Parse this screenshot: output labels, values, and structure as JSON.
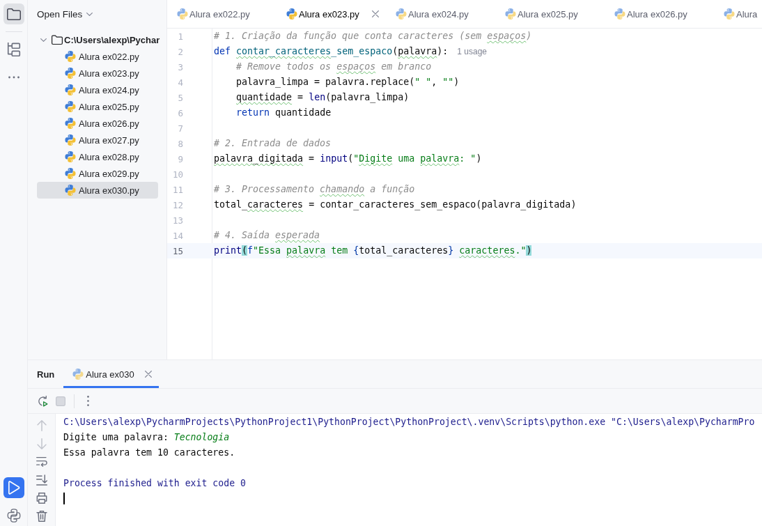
{
  "tool_stripe": {
    "top": [
      {
        "kind": "project",
        "selected": true,
        "focused": false
      },
      {
        "kind": "structure",
        "selected": false,
        "focused": false
      },
      {
        "kind": "more",
        "selected": false,
        "focused": false
      }
    ],
    "bottom": [
      {
        "kind": "run",
        "selected": true,
        "focused": true
      },
      {
        "kind": "python_console",
        "selected": false,
        "focused": false
      }
    ]
  },
  "project_panel": {
    "title": "Open Files",
    "tree": [
      {
        "label": "C:\\Users\\alexp\\Pychar",
        "expanded": true,
        "selected": false,
        "children": [
          {
            "label": "Alura ex022.py",
            "selected": false
          },
          {
            "label": "Alura ex023.py",
            "selected": false
          },
          {
            "label": "Alura ex024.py",
            "selected": false
          },
          {
            "label": "Alura ex025.py",
            "selected": false
          },
          {
            "label": "Alura ex026.py",
            "selected": false
          },
          {
            "label": "Alura ex027.py",
            "selected": false
          },
          {
            "label": "Alura ex028.py",
            "selected": false
          },
          {
            "label": "Alura ex029.py",
            "selected": false
          },
          {
            "label": "Alura ex030.py",
            "selected": true
          }
        ]
      }
    ]
  },
  "editor": {
    "tabs": [
      {
        "label": "Alura ex022.py",
        "selected": false
      },
      {
        "label": "Alura ex023.py",
        "selected": true
      },
      {
        "label": "Alura ex024.py",
        "selected": false
      },
      {
        "label": "Alura ex025.py",
        "selected": false
      },
      {
        "label": "Alura ex026.py",
        "selected": false
      },
      {
        "label": "Alura",
        "selected": false
      }
    ],
    "lines": [
      {
        "number": "1",
        "current": false,
        "tokens": [
          {
            "text": "# 1. Criação da função que conta caracteres (sem ",
            "kind": "comment",
            "typo": false
          },
          {
            "text": "espaços",
            "kind": "comment",
            "typo": true
          },
          {
            "text": ")",
            "kind": "comment",
            "typo": false
          }
        ]
      },
      {
        "number": "2",
        "current": false,
        "tokens": [
          {
            "text": "def",
            "kind": "keyword",
            "typo": false
          },
          {
            "text": " contar_caracteres",
            "kind": "function",
            "typo": true
          },
          {
            "text": "_sem_espaco",
            "kind": "function",
            "typo": false
          },
          {
            "text": "(",
            "kind": "plain",
            "typo": false
          },
          {
            "text": "palavra",
            "kind": "plain",
            "typo": true
          },
          {
            "text": "):",
            "kind": "plain",
            "typo": false
          }
        ],
        "hint": "1 usage"
      },
      {
        "number": "3",
        "current": false,
        "tokens": [
          {
            "text": "    # Remove todos os ",
            "kind": "comment",
            "typo": false
          },
          {
            "text": "espaços",
            "kind": "comment",
            "typo": true
          },
          {
            "text": " em branco",
            "kind": "comment",
            "typo": false
          }
        ]
      },
      {
        "number": "4",
        "current": false,
        "tokens": [
          {
            "text": "    palavra_limpa = palavra.replace(",
            "kind": "plain",
            "typo": false
          },
          {
            "text": "\" \"",
            "kind": "string",
            "typo": false
          },
          {
            "text": ", ",
            "kind": "plain",
            "typo": false
          },
          {
            "text": "\"\"",
            "kind": "string",
            "typo": false
          },
          {
            "text": ")",
            "kind": "plain",
            "typo": false
          }
        ]
      },
      {
        "number": "5",
        "current": false,
        "tokens": [
          {
            "text": "    quantidade",
            "kind": "plain",
            "typo": true
          },
          {
            "text": " = ",
            "kind": "plain",
            "typo": false
          },
          {
            "text": "len",
            "kind": "builtin",
            "typo": false
          },
          {
            "text": "(palavra_limpa)",
            "kind": "plain",
            "typo": false
          }
        ]
      },
      {
        "number": "6",
        "current": false,
        "tokens": [
          {
            "text": "    return",
            "kind": "keyword",
            "typo": false
          },
          {
            "text": " quantidade",
            "kind": "plain",
            "typo": false
          }
        ]
      },
      {
        "number": "7",
        "current": false
      },
      {
        "number": "8",
        "current": false,
        "tokens": [
          {
            "text": "# 2. Entrada de dados",
            "kind": "comment",
            "typo": false
          }
        ]
      },
      {
        "number": "9",
        "current": false,
        "tokens": [
          {
            "text": "palavra_digitada",
            "kind": "plain",
            "typo": true
          },
          {
            "text": " = ",
            "kind": "plain",
            "typo": false
          },
          {
            "text": "input",
            "kind": "builtin",
            "typo": false
          },
          {
            "text": "(",
            "kind": "plain",
            "typo": false
          },
          {
            "text": "\"",
            "kind": "string",
            "typo": false
          },
          {
            "text": "Digite",
            "kind": "string",
            "typo": true
          },
          {
            "text": " uma",
            "kind": "string",
            "typo": false
          },
          {
            "text": " palavra",
            "kind": "string",
            "typo": true
          },
          {
            "text": ": \"",
            "kind": "string",
            "typo": false
          },
          {
            "text": ")",
            "kind": "plain",
            "typo": false
          }
        ]
      },
      {
        "number": "10",
        "current": false
      },
      {
        "number": "11",
        "current": false,
        "tokens": [
          {
            "text": "# 3. Processamento ",
            "kind": "comment",
            "typo": false
          },
          {
            "text": "chamando",
            "kind": "comment",
            "typo": true
          },
          {
            "text": " a função",
            "kind": "comment",
            "typo": false
          }
        ]
      },
      {
        "number": "12",
        "current": false,
        "tokens": [
          {
            "text": "total_",
            "kind": "plain",
            "typo": false
          },
          {
            "text": "caracteres",
            "kind": "plain",
            "typo": true
          },
          {
            "text": " = contar_caracteres_sem_espaco(palavra_digitada)",
            "kind": "plain",
            "typo": false
          }
        ]
      },
      {
        "number": "13",
        "current": false
      },
      {
        "number": "14",
        "current": false,
        "tokens": [
          {
            "text": "# 4. Saída ",
            "kind": "comment",
            "typo": false
          },
          {
            "text": "esperada",
            "kind": "comment",
            "typo": true
          }
        ]
      },
      {
        "number": "15",
        "current": true,
        "tokens": [
          {
            "text": "print",
            "kind": "builtin",
            "typo": false
          },
          {
            "text": "(",
            "kind": "paren_match",
            "typo": false
          },
          {
            "text": "f",
            "kind": "fprefix",
            "typo": false
          },
          {
            "text": "\"Essa ",
            "kind": "string",
            "typo": false
          },
          {
            "text": "palavra",
            "kind": "string",
            "typo": true
          },
          {
            "text": " tem ",
            "kind": "string",
            "typo": false
          },
          {
            "text": "{",
            "kind": "fbrace",
            "typo": false
          },
          {
            "text": "total_caracteres",
            "kind": "plain",
            "typo": false
          },
          {
            "text": "}",
            "kind": "fbrace",
            "typo": false
          },
          {
            "text": " caracteres",
            "kind": "string",
            "typo": true
          },
          {
            "text": ".\"",
            "kind": "string",
            "typo": false
          },
          {
            "text": ")",
            "kind": "paren_match",
            "typo": false
          }
        ]
      }
    ]
  },
  "run_panel": {
    "title": "Run",
    "tabs": [
      {
        "label": "Alura ex030",
        "selected": true
      }
    ],
    "toolbar": [
      {
        "kind": "rerun",
        "disabled": false
      },
      {
        "kind": "stop",
        "disabled": true
      },
      {
        "kind": "more",
        "disabled": false
      }
    ],
    "side_tools": [
      {
        "kind": "up",
        "disabled": true
      },
      {
        "kind": "down",
        "disabled": true
      },
      {
        "kind": "soft_wrap",
        "disabled": false
      },
      {
        "kind": "scroll_end",
        "disabled": false
      },
      {
        "kind": "print",
        "disabled": false
      },
      {
        "kind": "clear",
        "disabled": false
      }
    ],
    "console": {
      "lines": [
        {
          "kind": "text",
          "segments": [
            {
              "text": "C:\\Users\\alexp\\PycharmProjects\\PythonProject1\\PythonProject\\PythonProject\\.venv\\Scripts\\python.exe \"C:\\Users\\alexp\\PycharmPro",
              "kind": "system"
            }
          ]
        },
        {
          "kind": "text",
          "segments": [
            {
              "text": "Digite uma palavra: ",
              "kind": "output"
            },
            {
              "text": "Tecnologia",
              "kind": "input"
            }
          ]
        },
        {
          "kind": "text",
          "segments": [
            {
              "text": "Essa palavra tem 10 caracteres.",
              "kind": "output"
            }
          ]
        },
        {
          "kind": "blank"
        },
        {
          "kind": "text",
          "segments": [
            {
              "text": "Process finished with exit code 0",
              "kind": "system"
            }
          ]
        }
      ],
      "cursor": true
    }
  }
}
